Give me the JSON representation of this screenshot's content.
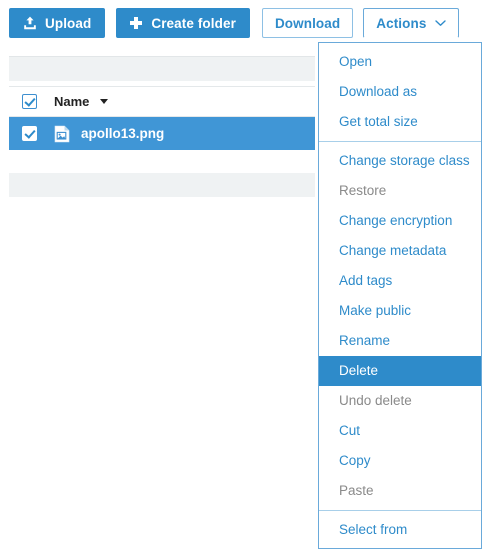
{
  "colors": {
    "primary_blue": "#2e8bca",
    "selection_blue": "#4096d6",
    "menu_border": "#6aaada",
    "strip_gray": "#eff2f3",
    "disabled_gray": "#8a8a8a"
  },
  "toolbar": {
    "upload_label": "Upload",
    "upload_icon": "upload-icon",
    "create_folder_label": "Create folder",
    "create_folder_icon": "plus-icon",
    "download_label": "Download",
    "actions_label": "Actions",
    "actions_caret_icon": "chevron-down-icon"
  },
  "table": {
    "header": {
      "select_all_checked": true,
      "name_label": "Name",
      "sort_caret_icon": "caret-down-icon"
    },
    "rows": [
      {
        "checked": true,
        "icon": "image-file-icon",
        "name": "apollo13.png",
        "selected": true
      }
    ]
  },
  "actions_menu": {
    "groups": [
      {
        "items": [
          {
            "label": "Open",
            "state": "enabled"
          },
          {
            "label": "Download as",
            "state": "enabled"
          },
          {
            "label": "Get total size",
            "state": "enabled"
          }
        ]
      },
      {
        "items": [
          {
            "label": "Change storage class",
            "state": "enabled"
          },
          {
            "label": "Restore",
            "state": "disabled"
          },
          {
            "label": "Change encryption",
            "state": "enabled"
          },
          {
            "label": "Change metadata",
            "state": "enabled"
          },
          {
            "label": "Add tags",
            "state": "enabled"
          },
          {
            "label": "Make public",
            "state": "enabled"
          },
          {
            "label": "Rename",
            "state": "enabled"
          },
          {
            "label": "Delete",
            "state": "highlighted"
          },
          {
            "label": "Undo delete",
            "state": "disabled"
          },
          {
            "label": "Cut",
            "state": "enabled"
          },
          {
            "label": "Copy",
            "state": "enabled"
          },
          {
            "label": "Paste",
            "state": "disabled"
          }
        ]
      },
      {
        "items": [
          {
            "label": "Select from",
            "state": "enabled"
          }
        ]
      }
    ]
  }
}
